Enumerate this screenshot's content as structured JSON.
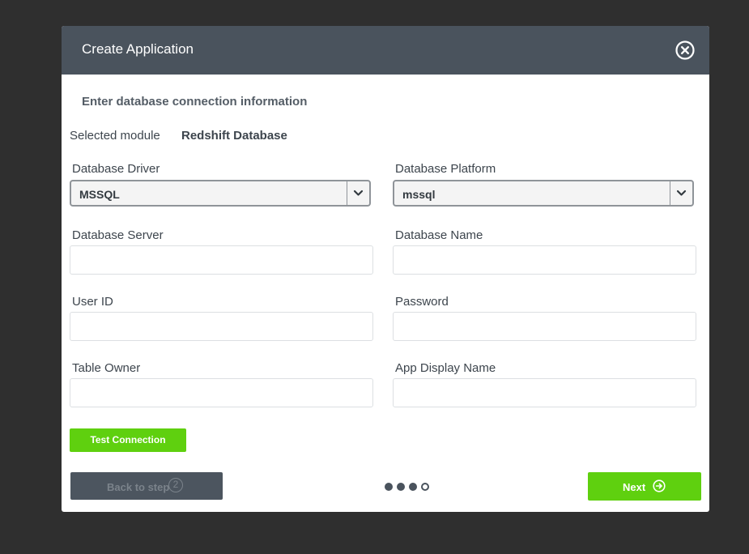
{
  "modal": {
    "title": "Create Application",
    "close_icon": "close-circle-icon"
  },
  "form": {
    "heading": "Enter database connection information",
    "selected_module_label": "Selected module",
    "selected_module_value": "Redshift Database",
    "database_driver": {
      "label": "Database Driver",
      "value": "MSSQL"
    },
    "database_platform": {
      "label": "Database Platform",
      "value": "mssql"
    },
    "database_server": {
      "label": "Database Server",
      "value": ""
    },
    "database_name": {
      "label": "Database Name",
      "value": ""
    },
    "user_id": {
      "label": "User ID",
      "value": ""
    },
    "password": {
      "label": "Password",
      "value": ""
    },
    "table_owner": {
      "label": "Table Owner",
      "value": ""
    },
    "app_display_name": {
      "label": "App Display Name",
      "value": ""
    }
  },
  "actions": {
    "test_connection": "Test Connection",
    "back_label": "Back to step",
    "back_step": "2",
    "next_label": "Next",
    "next_icon": "arrow-right-circle-icon"
  },
  "wizard": {
    "total_steps": 4,
    "filled_steps": 3
  },
  "colors": {
    "header": "#4a535d",
    "accent_green": "#5fd00f",
    "backdrop": "#2f2f2f"
  }
}
